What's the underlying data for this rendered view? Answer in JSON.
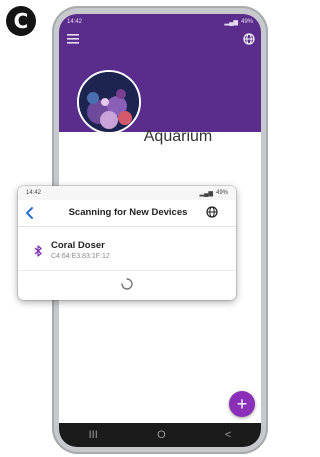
{
  "badge": {
    "letter": "C"
  },
  "app": {
    "status_time": "14:42",
    "status_right": "49%",
    "title": "Aquarium",
    "fab_label": "+"
  },
  "nav": {
    "recents": "III",
    "home": "O",
    "back": "<"
  },
  "scan": {
    "status_time": "14:42",
    "status_right": "49%",
    "title": "Scanning for New Devices",
    "devices": [
      {
        "name": "Coral Doser",
        "mac": "C4:64:E3:83:1F:12"
      }
    ]
  },
  "colors": {
    "header": "#5a2d8c",
    "fab": "#8b2fb8",
    "bluetooth": "#7b2fb0",
    "back": "#2a6fd6"
  },
  "icons": [
    "menu-icon",
    "globe-icon",
    "back-icon",
    "bluetooth-icon",
    "spinner-icon"
  ]
}
